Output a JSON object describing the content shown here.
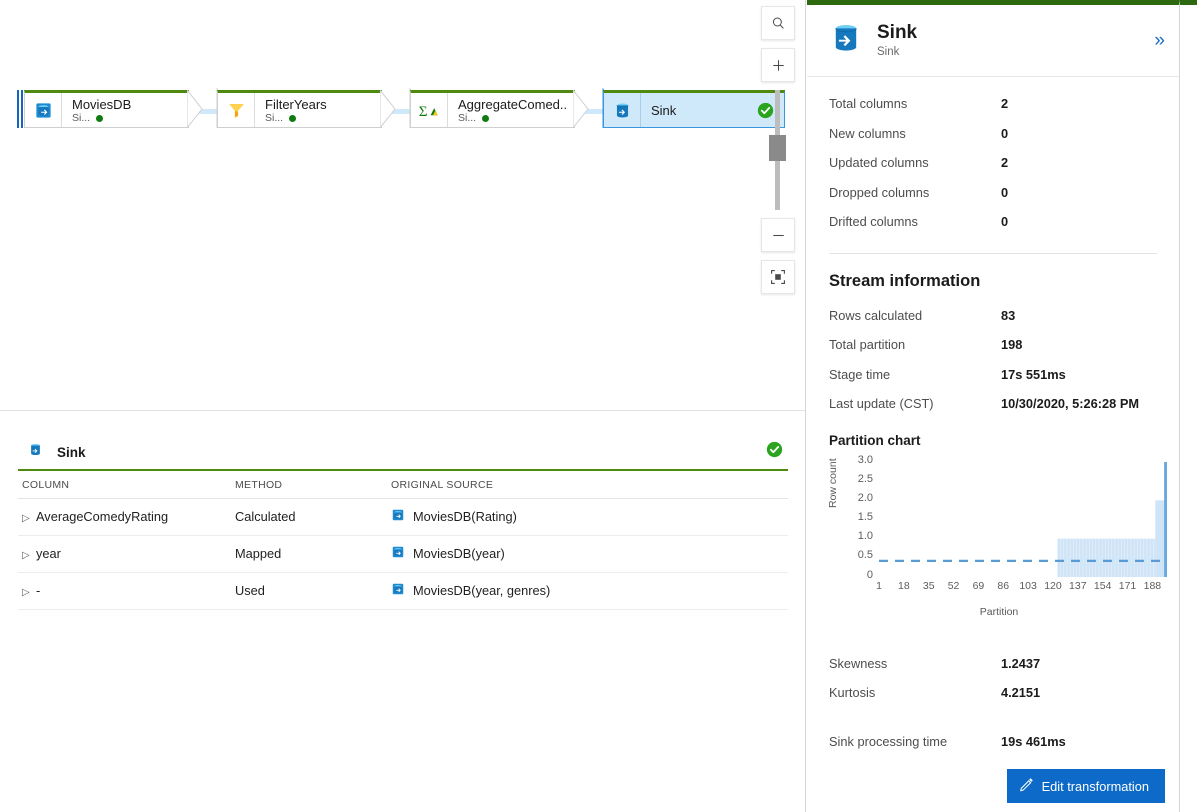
{
  "canvas": {
    "nodes": [
      {
        "name": "MoviesDB",
        "subtitle": "Si...",
        "icon": "source-database-icon",
        "selected": false,
        "status": "ok-dot"
      },
      {
        "name": "FilterYears",
        "subtitle": "Si...",
        "icon": "filter-funnel-icon",
        "selected": false,
        "status": "ok-dot"
      },
      {
        "name": "AggregateComed...",
        "subtitle": "Si...",
        "icon": "aggregate-sigma-icon",
        "selected": false,
        "status": "ok-dot"
      },
      {
        "name": "Sink",
        "subtitle": "",
        "icon": "sink-database-icon",
        "selected": true,
        "status": "ok-check"
      }
    ],
    "toolbar": [
      {
        "name": "search-icon",
        "label": "Search"
      },
      {
        "name": "zoom-in-icon",
        "label": "Zoom in"
      },
      {
        "name": "zoom-slider",
        "label": "Zoom level"
      },
      {
        "name": "zoom-out-icon",
        "label": "Zoom out"
      },
      {
        "name": "fit-to-screen-icon",
        "label": "Fit to screen"
      }
    ]
  },
  "inspect": {
    "title": "Sink",
    "icon": "sink-database-icon",
    "status": "ok-check",
    "columns": [
      "COLUMN",
      "METHOD",
      "ORIGINAL SOURCE"
    ],
    "rows": [
      {
        "column": "AverageComedyRating",
        "method": "Calculated",
        "source": "MoviesDB(Rating)"
      },
      {
        "column": "year",
        "method": "Mapped",
        "source": "MoviesDB(year)"
      },
      {
        "column": "-",
        "method": "Used",
        "source": "MoviesDB(year, genres)"
      }
    ]
  },
  "panel": {
    "title": "Sink",
    "subtitle": "Sink",
    "collapse_icon": "chevron-double-right-icon",
    "column_stats": [
      {
        "label": "Total columns",
        "value": "2"
      },
      {
        "label": "New columns",
        "value": "0"
      },
      {
        "label": "Updated columns",
        "value": "2"
      },
      {
        "label": "Dropped columns",
        "value": "0"
      },
      {
        "label": "Drifted columns",
        "value": "0"
      }
    ],
    "stream_section_title": "Stream information",
    "stream_stats": [
      {
        "label": "Rows calculated",
        "value": "83"
      },
      {
        "label": "Total partition",
        "value": "198"
      },
      {
        "label": "Stage time",
        "value": "17s 551ms"
      },
      {
        "label": "Last update (CST)",
        "value": "10/30/2020, 5:26:28 PM"
      }
    ],
    "distribution_stats": [
      {
        "label": "Skewness",
        "value": "1.2437"
      },
      {
        "label": "Kurtosis",
        "value": "4.2151"
      }
    ],
    "processing": [
      {
        "label": "Sink processing time",
        "value": "19s 461ms"
      }
    ],
    "edit_button": {
      "label": "Edit transformation",
      "icon": "pencil-icon"
    }
  },
  "chart_data": {
    "type": "bar",
    "title": "Partition chart",
    "xlabel": "Partition",
    "ylabel": "Row count",
    "xticks": [
      1,
      18,
      35,
      52,
      69,
      86,
      103,
      120,
      137,
      154,
      171,
      188
    ],
    "yticks": [
      "3.0",
      "2.5",
      "2.0",
      "1.5",
      "1.0",
      "0.5",
      "0"
    ],
    "xlim": [
      1,
      198
    ],
    "ylim": [
      0,
      3.0
    ],
    "grid": false,
    "average_line": 0.42,
    "bar_color": "#cfe4f7",
    "average_line_color": "#5b9bd5",
    "series": [
      {
        "name": "Row count",
        "bars": [
          {
            "x_start": 123,
            "x_end": 190,
            "value": 1.0
          },
          {
            "x_start": 190,
            "x_end": 196,
            "value": 2.0
          },
          {
            "x_start": 196,
            "x_end": 198,
            "value": 3.0
          }
        ]
      }
    ]
  }
}
